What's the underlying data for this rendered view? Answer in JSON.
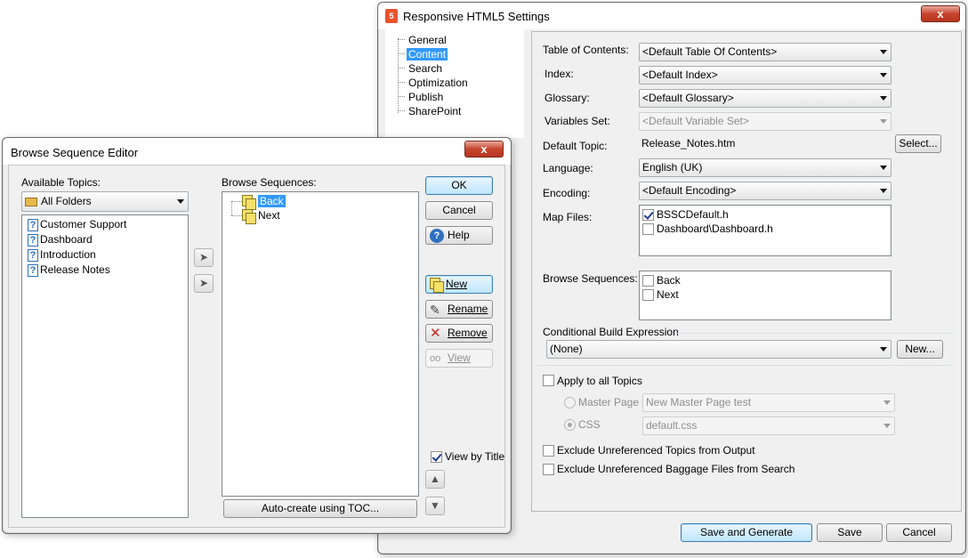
{
  "settings": {
    "title": "Responsive HTML5 Settings",
    "close_label": "x",
    "nav": [
      "General",
      "Content",
      "Search",
      "Optimization",
      "Publish",
      "SharePoint"
    ],
    "nav_selected": "Content",
    "toc_label": "Table of Contents:",
    "toc_value": "<Default Table Of Contents>",
    "index_label": "Index:",
    "index_value": "<Default Index>",
    "glossary_label": "Glossary:",
    "glossary_value": "<Default Glossary>",
    "variables_label": "Variables Set:",
    "variables_value": "<Default Variable Set>",
    "default_topic_label": "Default Topic:",
    "default_topic_value": "Release_Notes.htm",
    "select_button": "Select...",
    "language_label": "Language:",
    "language_value": "English (UK)",
    "encoding_label": "Encoding:",
    "encoding_value": "<Default Encoding>",
    "map_files_label": "Map Files:",
    "map_files": [
      {
        "label": "BSSCDefault.h",
        "checked": true
      },
      {
        "label": "Dashboard\\Dashboard.h",
        "checked": false
      }
    ],
    "browse_seq_label": "Browse Sequences:",
    "browse_seqs": [
      {
        "label": "Back",
        "checked": false
      },
      {
        "label": "Next",
        "checked": false
      }
    ],
    "cbe_label": "Conditional Build Expression",
    "cbe_value": "(None)",
    "new_button": "New...",
    "apply_all_label": "Apply to all Topics",
    "master_page_label": "Master Page",
    "master_page_value": "New Master Page test",
    "css_label": "CSS",
    "css_value": "default.css",
    "exclude_topics_label": "Exclude Unreferenced Topics from Output",
    "exclude_baggage_label": "Exclude Unreferenced Baggage Files from Search",
    "save_generate_button": "Save and Generate",
    "save_button": "Save",
    "cancel_button": "Cancel"
  },
  "editor": {
    "title": "Browse Sequence Editor",
    "close_label": "x",
    "available_label": "Available Topics:",
    "folder_value": "All Folders",
    "topics": [
      "Customer Support",
      "Dashboard",
      "Introduction",
      "Release Notes"
    ],
    "sequences_label": "Browse Sequences:",
    "sequences": [
      "Back",
      "Next"
    ],
    "sequence_selected": "Back",
    "ok_button": "OK",
    "cancel_button": "Cancel",
    "help_button": "Help",
    "new_button": "New",
    "rename_button": "Rename",
    "remove_button": "Remove",
    "view_button": "View",
    "view_by_title_label": "View by Title",
    "auto_create_button": "Auto-create using TOC..."
  }
}
